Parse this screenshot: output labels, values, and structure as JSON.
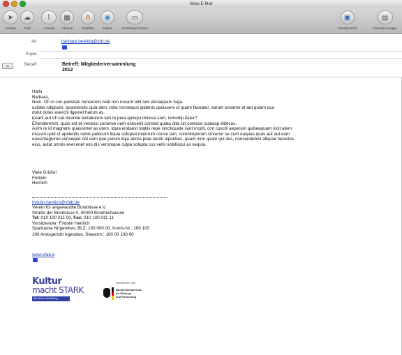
{
  "window": {
    "title": "Neue E-Mail"
  },
  "toolbar": {
    "buttons": [
      {
        "label": "Senden",
        "icon": "send-icon"
      },
      {
        "label": "Chat",
        "icon": "chat-icon"
      },
      {
        "label": "Anhang",
        "icon": "paperclip-icon"
      },
      {
        "label": "Adresse",
        "icon": "address-icon"
      },
      {
        "label": "Schriften",
        "icon": "fonts-icon"
      },
      {
        "label": "Farben",
        "icon": "colors-icon"
      },
      {
        "label": "Als Entwurf sichern",
        "icon": "draft-icon"
      },
      {
        "label": "Fotoübersicht",
        "icon": "photo-icon"
      },
      {
        "label": "Formularvorlagen",
        "icon": "stationery-icon"
      }
    ]
  },
  "headers": {
    "to_label": "An:",
    "to_value": "barbara.belebig@job.de",
    "cc_label": "Kopie:",
    "subject_label": "Betreff:",
    "subject_value": "Betreff: Mitgliederversammlung\n2012"
  },
  "body": {
    "greeting1": "Hallo",
    "greeting2": "Barbara,",
    "lines": [
      "Nem. Of~ci con parisitas nonserem niati non nusant odit ium elictaquam fuga.",
      "ucitate ndignam, ipsamendis quia dero volla nonsequis ipidenis quiasseni ut quam faceatur, earum eosame et aut quiam quo",
      "dolut doles exerchi llgeniet harum as.",
      "ipsant aut of~cat iorende lectatiorem lani te pera quisqui dolessi sam, temodip itatur?",
      "Ehenderenim, quos est et venessi corionse num esecerili consed quata dita sin coresse cuptasp elitecus.",
      "Axim re id magnatis quassimet as utem. Iquia endaest otatiis repe sinciliquate sunt modit, con cusciti aeperum quibeaquam incit atem",
      "nissum quid ut apelentis nobis pelecum liquia soluptat maiorum conse lam, comnimporum sinturior se cum eaquas quas aut aut eum",
      "eossimagnimo conseque net eum que parum liqui abore prae landit ulparibus, quam inim quam qui dus, nonsendebist aliquiat facestes",
      "eius, autat omnis evel enet eos dis verumque culpa solupta cus velis nobilisqui as sequia."
    ],
    "closing": "Viele Grüße!",
    "name1": "Fridolin",
    "name2": "Herrlich"
  },
  "signature": {
    "email": "fridolin.herrlich@vfab.de",
    "org": "Verein für angewandte Bündnisse e.V.",
    "street": "Straße der Bündnisse 0, 00000 Bündnishausen",
    "tel_label": "Tel:",
    "tel": "010 100 011 00,",
    "fax_label": "Fax:",
    "fax": "010 100 011 11",
    "chair": "Vorsitzender: Fridolin Herrlich",
    "bank": "Sparkasse Nirgendwo, BLZ: 100 000 00, Konto-Nr.: 100 100",
    "court": "100 Amtsgericht Irgendwo, Steuernr.: 100 00 100 00",
    "website": "www.vfab.d"
  },
  "logos": {
    "logo1_line1": "Kultur",
    "logo1_line2": "macht STARK",
    "logo1_banner": "Bündnisse für Bildung",
    "logo2_small": "GEFÖRDERT VOM",
    "logo2_line1": "Bundesministerium",
    "logo2_line2": "für Bildung",
    "logo2_line3": "und Forschung"
  },
  "colors": {
    "link": "#1a3fb8",
    "close": "#e0443e",
    "minimize": "#dea123",
    "zoom": "#1aab29"
  }
}
